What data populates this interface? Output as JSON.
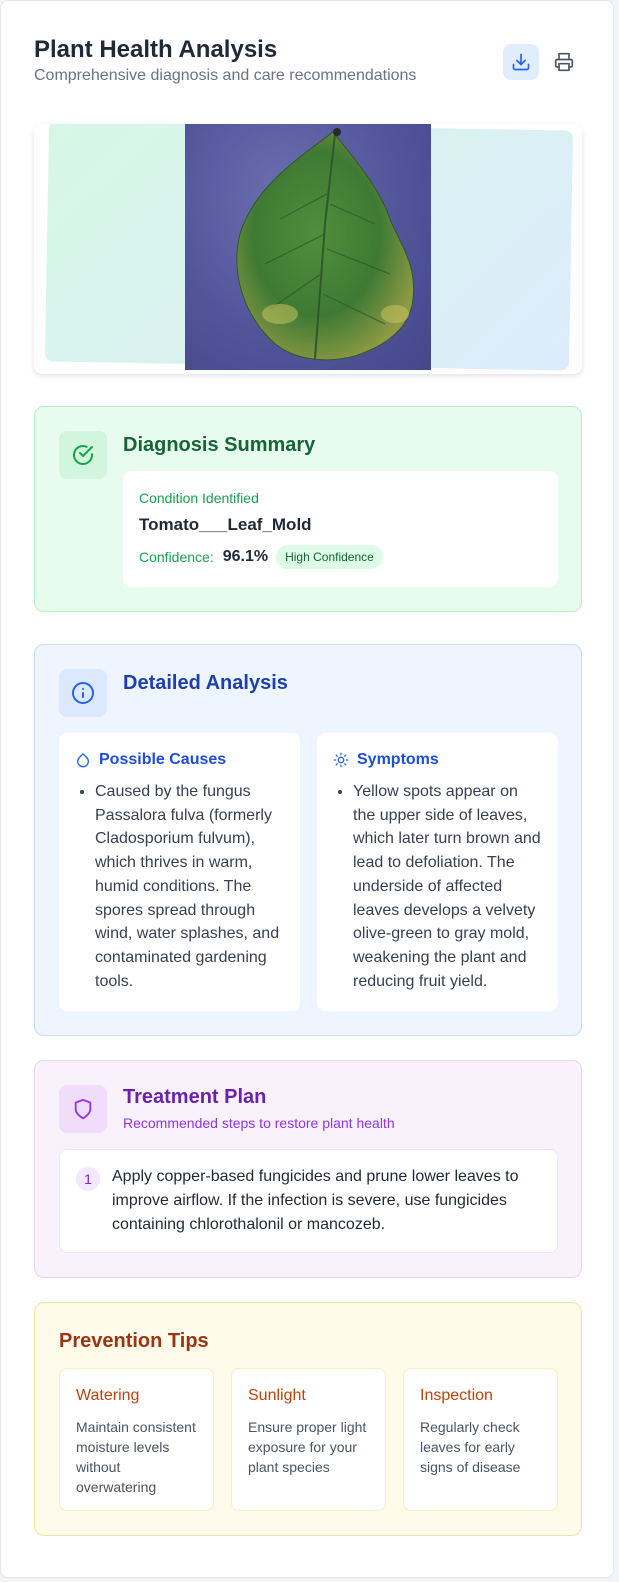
{
  "header": {
    "title": "Plant Health Analysis",
    "subtitle": "Comprehensive diagnosis and care recommendations"
  },
  "icons": {
    "download": "download-icon",
    "print": "printer-icon",
    "diagnosis": "check-circle-icon",
    "analysis": "info-icon",
    "causes": "droplet-icon",
    "symptoms": "sun-icon",
    "treatment": "shield-icon"
  },
  "colors": {
    "diagnosis_accent": "#16a34a",
    "analysis_accent": "#1d4ed8",
    "treatment_accent": "#7e22ce",
    "prevention_accent": "#9a3412"
  },
  "diagnosis": {
    "title": "Diagnosis Summary",
    "condition_label": "Condition Identified",
    "condition_name": "Tomato___Leaf_Mold",
    "confidence_label": "Confidence:",
    "confidence_value": "96.1%",
    "confidence_badge": "High Confidence"
  },
  "analysis": {
    "title": "Detailed Analysis",
    "causes": {
      "heading": "Possible Causes",
      "items": [
        "Caused by the fungus Passalora fulva (formerly Cladosporium fulvum), which thrives in warm, humid conditions. The spores spread through wind, water splashes, and contaminated gardening tools."
      ]
    },
    "symptoms": {
      "heading": "Symptoms",
      "items": [
        "Yellow spots appear on the upper side of leaves, which later turn brown and lead to defoliation. The underside of affected leaves develops a velvety olive-green to gray mold, weakening the plant and reducing fruit yield."
      ]
    }
  },
  "treatment": {
    "title": "Treatment Plan",
    "subtitle": "Recommended steps to restore plant health",
    "steps": [
      {
        "number": "1",
        "text": "Apply copper-based fungicides and prune lower leaves to improve airflow. If the infection is severe, use fungicides containing chlorothalonil or mancozeb."
      }
    ]
  },
  "prevention": {
    "title": "Prevention Tips",
    "tips": [
      {
        "title": "Watering",
        "text": "Maintain consistent moisture levels without overwatering"
      },
      {
        "title": "Sunlight",
        "text": "Ensure proper light exposure for your plant species"
      },
      {
        "title": "Inspection",
        "text": "Regularly check leaves for early signs of disease"
      }
    ]
  }
}
